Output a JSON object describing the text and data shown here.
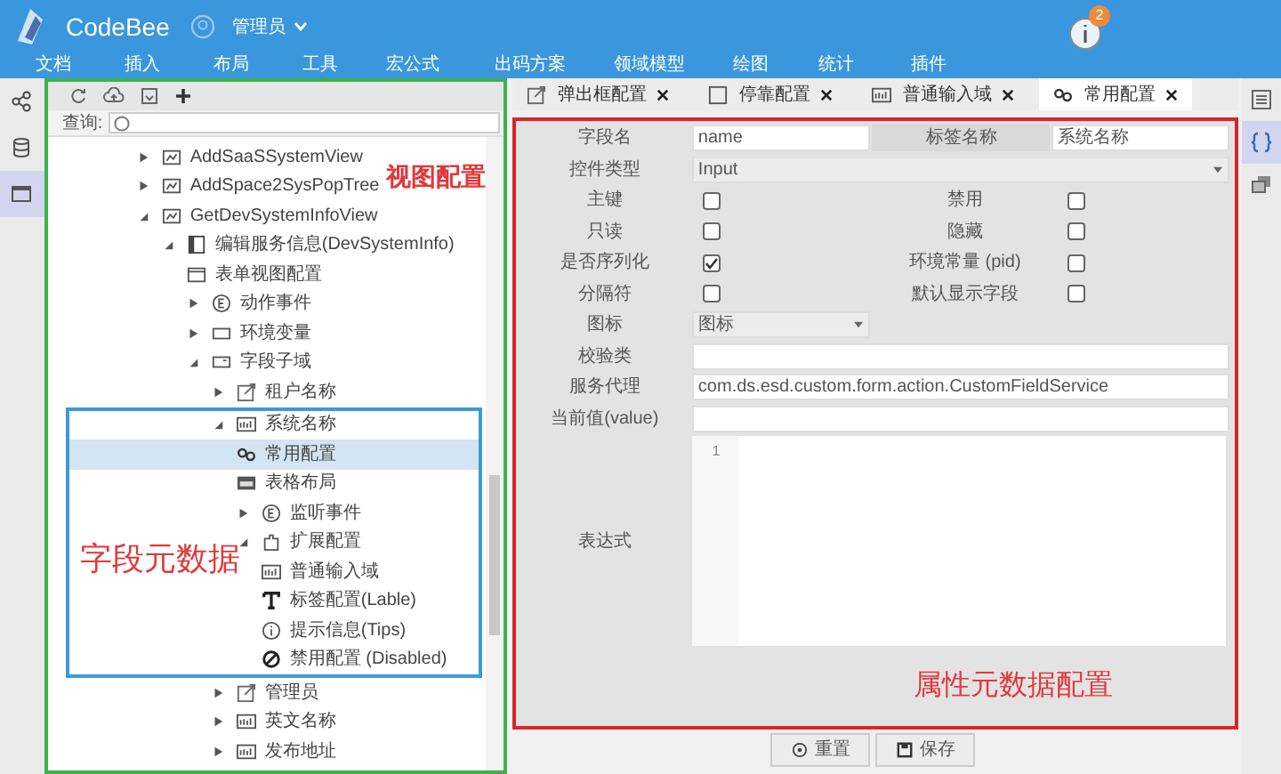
{
  "app": {
    "title": "CodeBee",
    "user": "管理员",
    "notification_count": "2"
  },
  "menu": [
    "文档",
    "插入",
    "布局",
    "工具",
    "宏公式",
    "出码方案",
    "领域模型",
    "绘图",
    "统计",
    "插件"
  ],
  "left_rail": [
    {
      "selected": false
    },
    {
      "selected": false
    },
    {
      "selected": true
    }
  ],
  "tree_panel": {
    "search_label": "查询:",
    "annotation": "视图配置",
    "nodes": [
      {
        "label": "AddSaaSSystemView",
        "kind": "view",
        "expanded": false,
        "selected": false
      },
      {
        "label": "AddSpace2SysPopTree",
        "kind": "view",
        "expanded": false,
        "selected": false
      },
      {
        "label": "GetDevSystemInfoView",
        "kind": "view",
        "expanded": true,
        "selected": false,
        "children": [
          {
            "label": "编辑服务信息(DevSystemInfo)",
            "kind": "form",
            "expanded": true,
            "selected": false,
            "children": [
              {
                "label": "表单视图配置",
                "kind": "window",
                "selected": false
              },
              {
                "label": "动作事件",
                "kind": "event",
                "expanded": false,
                "selected": false
              },
              {
                "label": "环境变量",
                "kind": "env",
                "expanded": false,
                "selected": false
              },
              {
                "label": "字段子域",
                "kind": "field",
                "expanded": true,
                "selected": false,
                "children": [
                  {
                    "label": "租户名称",
                    "kind": "link",
                    "expanded": false,
                    "selected": false
                  },
                  {
                    "label": "系统名称",
                    "kind": "text",
                    "expanded": true,
                    "selected": false,
                    "annotation": "字段元数据",
                    "children": [
                      {
                        "label": "常用配置",
                        "kind": "config",
                        "selected": true
                      },
                      {
                        "label": "表格布局",
                        "kind": "layout",
                        "selected": false
                      },
                      {
                        "label": "监听事件",
                        "kind": "event",
                        "expanded": false,
                        "selected": false
                      },
                      {
                        "label": "扩展配置",
                        "kind": "extension",
                        "expanded": true,
                        "selected": false,
                        "children": [
                          {
                            "label": "普通输入域",
                            "kind": "text",
                            "selected": false
                          },
                          {
                            "label": "标签配置(Lable)",
                            "kind": "label",
                            "selected": false
                          },
                          {
                            "label": "提示信息(Tips)",
                            "kind": "tips",
                            "selected": false
                          },
                          {
                            "label": "禁用配置 (Disabled)",
                            "kind": "disabled",
                            "selected": false
                          }
                        ]
                      }
                    ]
                  },
                  {
                    "label": "管理员",
                    "kind": "link",
                    "expanded": false,
                    "selected": false
                  },
                  {
                    "label": "英文名称",
                    "kind": "text",
                    "expanded": false,
                    "selected": false
                  },
                  {
                    "label": "发布地址",
                    "kind": "text",
                    "expanded": false,
                    "selected": false
                  }
                ]
              }
            ]
          }
        ]
      }
    ]
  },
  "tabs": [
    {
      "label": "弹出框配置",
      "selected": false
    },
    {
      "label": "停靠配置",
      "selected": false
    },
    {
      "label": "普通输入域",
      "selected": false
    },
    {
      "label": "常用配置",
      "selected": true
    }
  ],
  "form": {
    "annotation": "属性元数据配置",
    "rows": [
      {
        "kind": "pair",
        "label": "字段名",
        "value": "name",
        "label2": "标签名称",
        "value2": "系统名称"
      },
      {
        "kind": "select",
        "label": "控件类型",
        "value": "Input"
      },
      {
        "kind": "checks",
        "label": "主键",
        "checked": false,
        "label2": "禁用",
        "checked2": false
      },
      {
        "kind": "checks",
        "label": "只读",
        "checked": false,
        "label2": "隐藏",
        "checked2": false
      },
      {
        "kind": "checks",
        "label": "是否序列化",
        "checked": true,
        "label2": "环境常量 (pid)",
        "checked2": false
      },
      {
        "kind": "checks",
        "label": "分隔符",
        "checked": false,
        "label2": "默认显示字段",
        "checked2": false
      },
      {
        "kind": "select_short",
        "label": "图标",
        "value": "图标"
      },
      {
        "kind": "input",
        "label": "校验类"
      },
      {
        "kind": "input",
        "label": "服务代理",
        "value": "com.ds.esd.custom.form.action.CustomFieldService"
      },
      {
        "kind": "input",
        "label": "当前值(value)"
      },
      {
        "kind": "editor",
        "label": "表达式",
        "line_number": "1"
      }
    ]
  },
  "buttons": [
    {
      "label": "重置"
    },
    {
      "label": "保存"
    }
  ],
  "right_rail": [
    {
      "selected": false
    },
    {
      "selected": true
    },
    {
      "selected": false
    }
  ]
}
